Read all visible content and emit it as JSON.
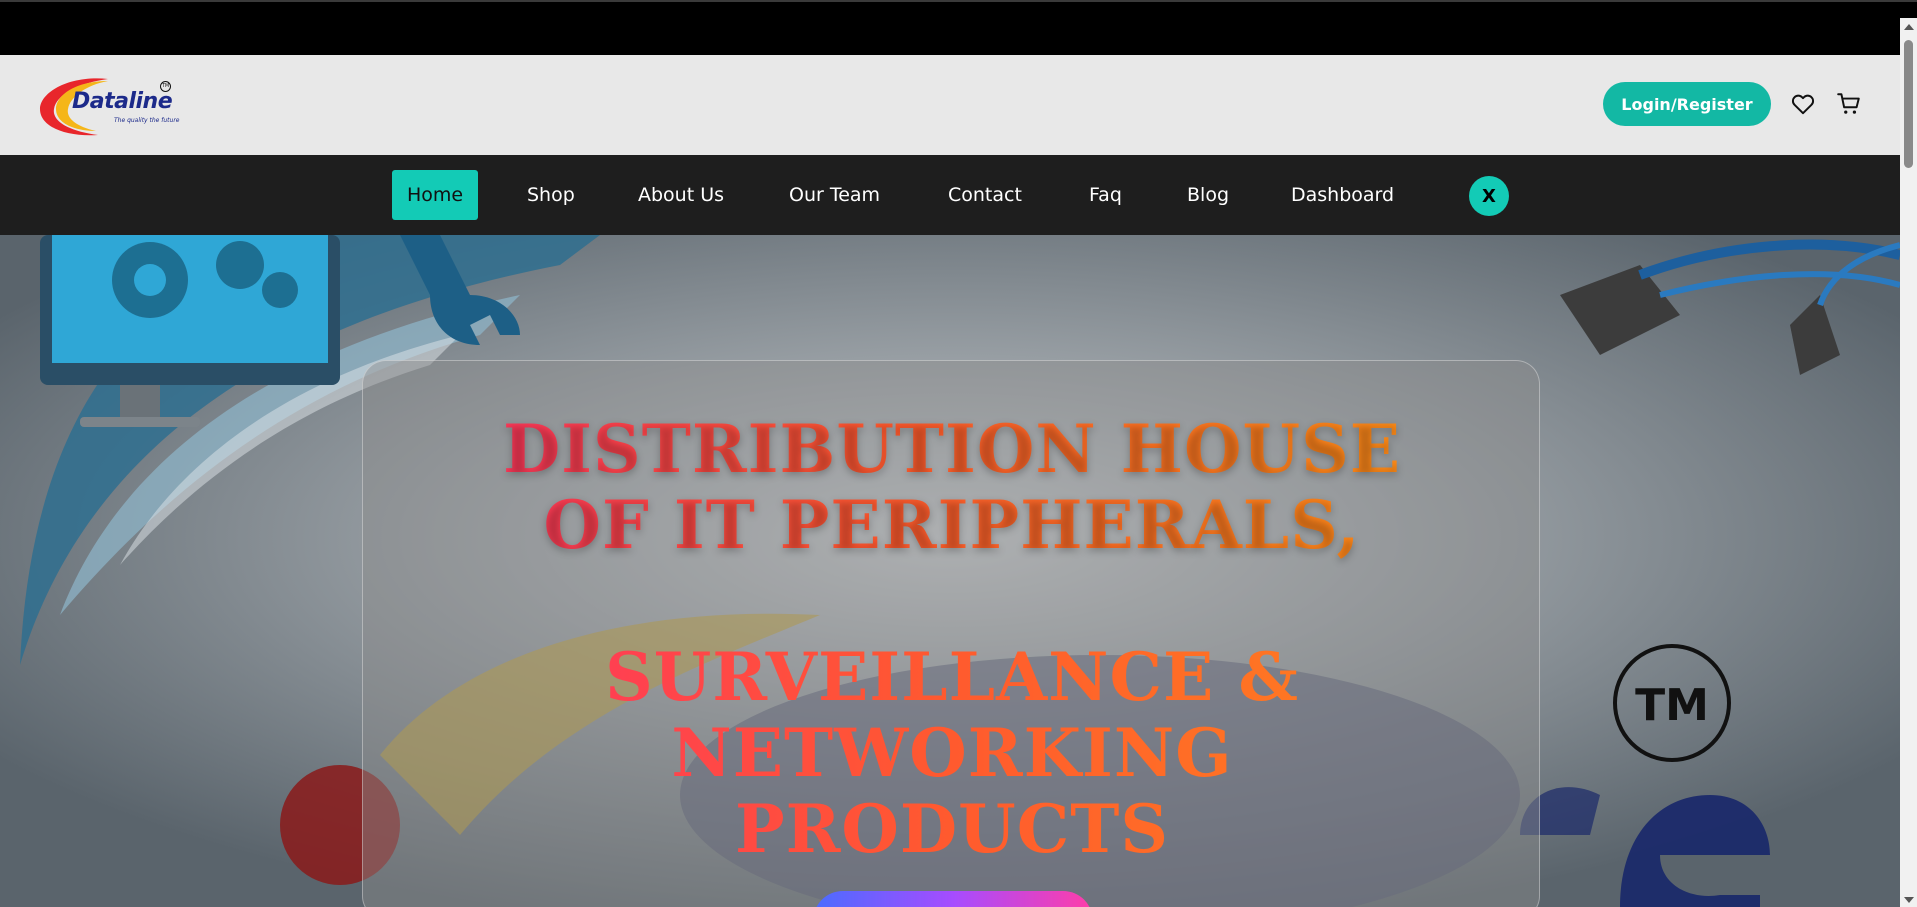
{
  "brand": {
    "name": "Dataline",
    "tagline": "The quality the future",
    "tm": "TM",
    "colors": {
      "accent": "#13cbb6",
      "login": "#13b8a4",
      "navy": "#1c2a8a"
    }
  },
  "header": {
    "login_label": "Login/Register",
    "wishlist_icon": "heart-icon",
    "cart_icon": "cart-icon"
  },
  "nav": {
    "items": [
      {
        "label": "Home",
        "active": true
      },
      {
        "label": "Shop"
      },
      {
        "label": "About Us"
      },
      {
        "label": "Our Team"
      },
      {
        "label": "Contact"
      },
      {
        "label": "Faq"
      },
      {
        "label": "Blog"
      },
      {
        "label": "Dashboard"
      }
    ],
    "close_label": "X"
  },
  "hero": {
    "title_line1": "DISTRIBUTION HOUSE",
    "title_line2": "OF IT PERIPHERALS,",
    "sub_line1": "SURVEILLANCE &",
    "sub_line2": "NETWORKING",
    "sub_line3": "PRODUCTS",
    "background_tm": "TM"
  }
}
